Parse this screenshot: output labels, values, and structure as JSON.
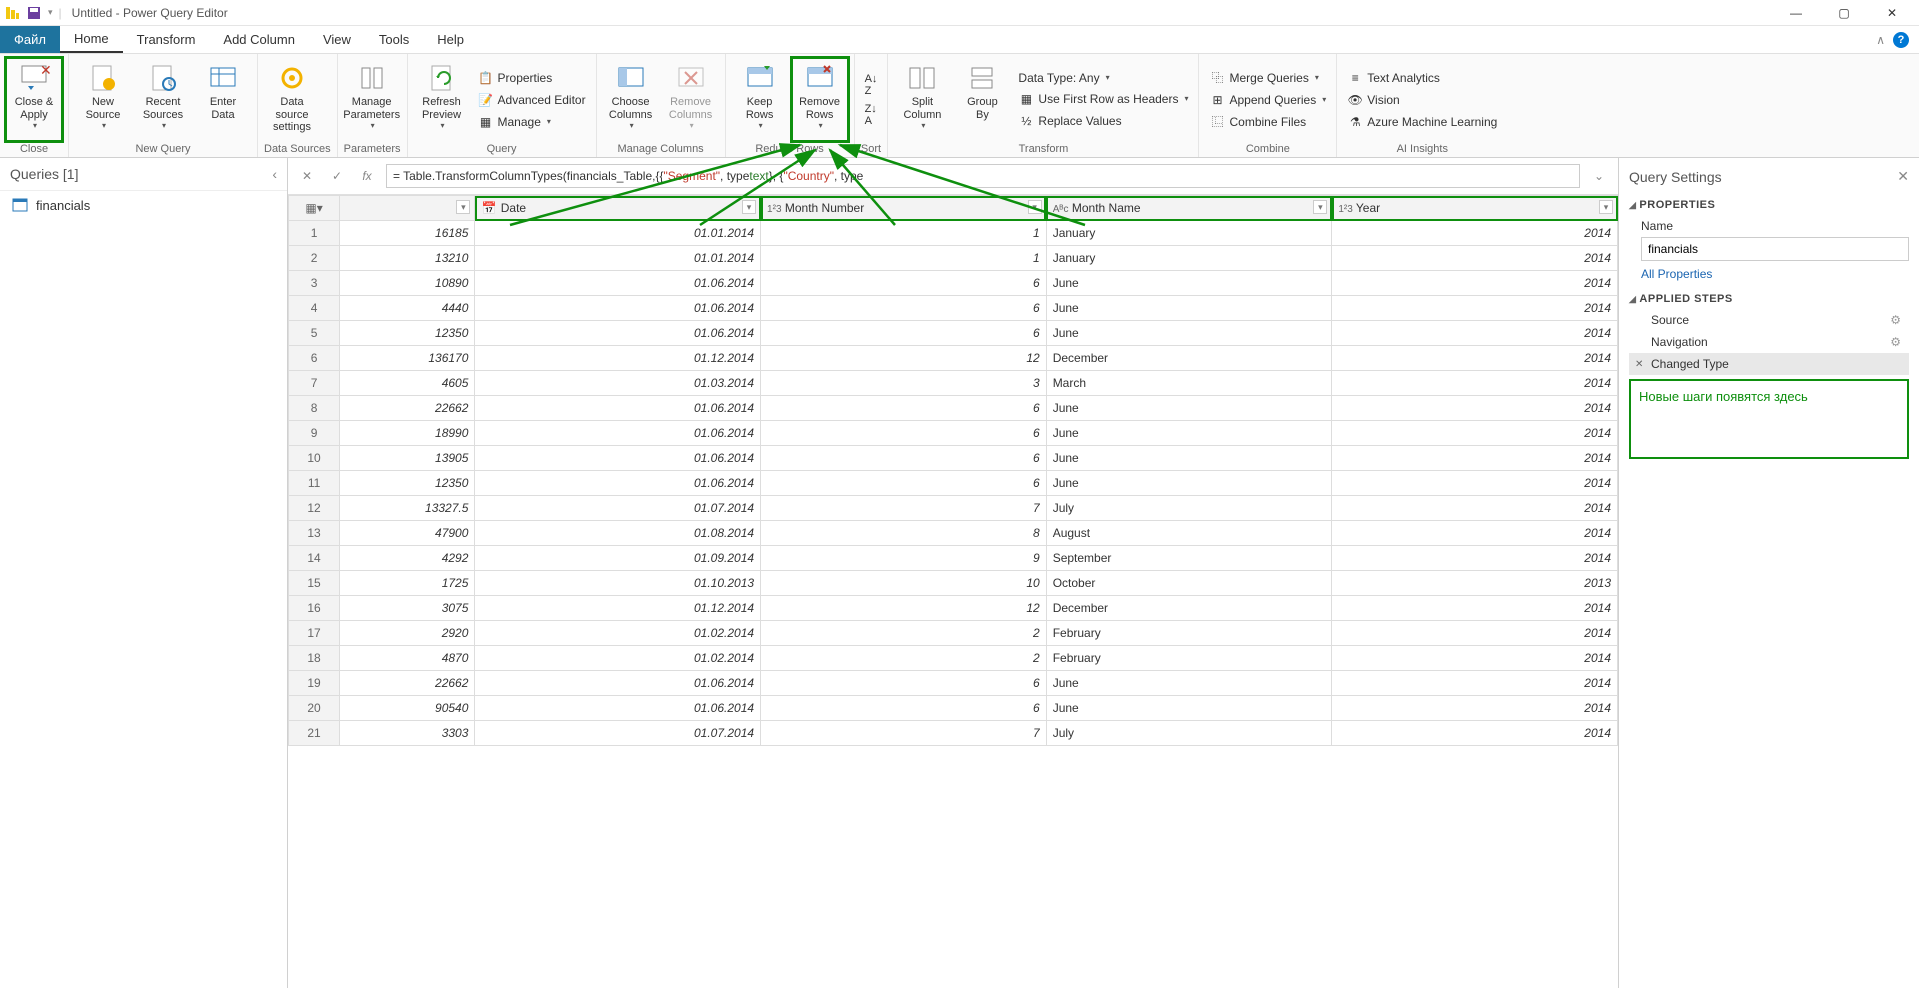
{
  "titlebar": {
    "title": "Untitled - Power Query Editor"
  },
  "menu": {
    "file": "Файл",
    "tabs": [
      "Home",
      "Transform",
      "Add Column",
      "View",
      "Tools",
      "Help"
    ]
  },
  "ribbon": {
    "close": {
      "close_apply": "Close &\nApply",
      "group": "Close"
    },
    "newquery": {
      "new_source": "New\nSource",
      "recent_sources": "Recent\nSources",
      "enter_data": "Enter\nData",
      "group": "New Query"
    },
    "datasources": {
      "btn": "Data source\nsettings",
      "group": "Data Sources"
    },
    "params": {
      "btn": "Manage\nParameters",
      "group": "Parameters"
    },
    "query": {
      "refresh": "Refresh\nPreview",
      "properties": "Properties",
      "advanced": "Advanced Editor",
      "manage": "Manage",
      "group": "Query"
    },
    "managecols": {
      "choose": "Choose\nColumns",
      "remove": "Remove\nColumns",
      "group": "Manage Columns"
    },
    "reducerows": {
      "keep": "Keep\nRows",
      "remove": "Remove\nRows",
      "group": "Reduce Rows"
    },
    "sort": {
      "group": "Sort"
    },
    "transform": {
      "split": "Split\nColumn",
      "group_by": "Group\nBy",
      "datatype": "Data Type: Any",
      "firstrow": "Use First Row as Headers",
      "replace": "Replace Values",
      "group": "Transform"
    },
    "combine": {
      "merge": "Merge Queries",
      "append": "Append Queries",
      "combine_files": "Combine Files",
      "group": "Combine"
    },
    "ai": {
      "text": "Text Analytics",
      "vision": "Vision",
      "aml": "Azure Machine Learning",
      "group": "AI Insights"
    }
  },
  "queries": {
    "header": "Queries [1]",
    "items": [
      "financials"
    ]
  },
  "formula": {
    "prefix": "= Table.TransformColumnTypes(financials_Table,{{",
    "seg": "\"Segment\"",
    "t1": ", type ",
    "text": "text",
    "mid": "}, {",
    "ctry": "\"Country\"",
    "t2": ", type"
  },
  "columns": [
    {
      "icon": "cal",
      "name": "Date"
    },
    {
      "icon": "123",
      "name": "Month Number"
    },
    {
      "icon": "abc",
      "name": "Month Name"
    },
    {
      "icon": "123",
      "name": "Year"
    }
  ],
  "rows": [
    [
      "16185",
      "01.01.2014",
      "1",
      "January",
      "2014"
    ],
    [
      "13210",
      "01.01.2014",
      "1",
      "January",
      "2014"
    ],
    [
      "10890",
      "01.06.2014",
      "6",
      "June",
      "2014"
    ],
    [
      "4440",
      "01.06.2014",
      "6",
      "June",
      "2014"
    ],
    [
      "12350",
      "01.06.2014",
      "6",
      "June",
      "2014"
    ],
    [
      "136170",
      "01.12.2014",
      "12",
      "December",
      "2014"
    ],
    [
      "4605",
      "01.03.2014",
      "3",
      "March",
      "2014"
    ],
    [
      "22662",
      "01.06.2014",
      "6",
      "June",
      "2014"
    ],
    [
      "18990",
      "01.06.2014",
      "6",
      "June",
      "2014"
    ],
    [
      "13905",
      "01.06.2014",
      "6",
      "June",
      "2014"
    ],
    [
      "12350",
      "01.06.2014",
      "6",
      "June",
      "2014"
    ],
    [
      "13327.5",
      "01.07.2014",
      "7",
      "July",
      "2014"
    ],
    [
      "47900",
      "01.08.2014",
      "8",
      "August",
      "2014"
    ],
    [
      "4292",
      "01.09.2014",
      "9",
      "September",
      "2014"
    ],
    [
      "1725",
      "01.10.2013",
      "10",
      "October",
      "2013"
    ],
    [
      "3075",
      "01.12.2014",
      "12",
      "December",
      "2014"
    ],
    [
      "2920",
      "01.02.2014",
      "2",
      "February",
      "2014"
    ],
    [
      "4870",
      "01.02.2014",
      "2",
      "February",
      "2014"
    ],
    [
      "22662",
      "01.06.2014",
      "6",
      "June",
      "2014"
    ],
    [
      "90540",
      "01.06.2014",
      "6",
      "June",
      "2014"
    ],
    [
      "3303",
      "01.07.2014",
      "7",
      "July",
      "2014"
    ]
  ],
  "settings": {
    "header": "Query Settings",
    "prop_hdr": "PROPERTIES",
    "name_lbl": "Name",
    "name_val": "financials",
    "all_props": "All Properties",
    "steps_hdr": "APPLIED STEPS",
    "steps": [
      "Source",
      "Navigation",
      "Changed Type"
    ],
    "note": "Новые шаги появятся здесь"
  }
}
